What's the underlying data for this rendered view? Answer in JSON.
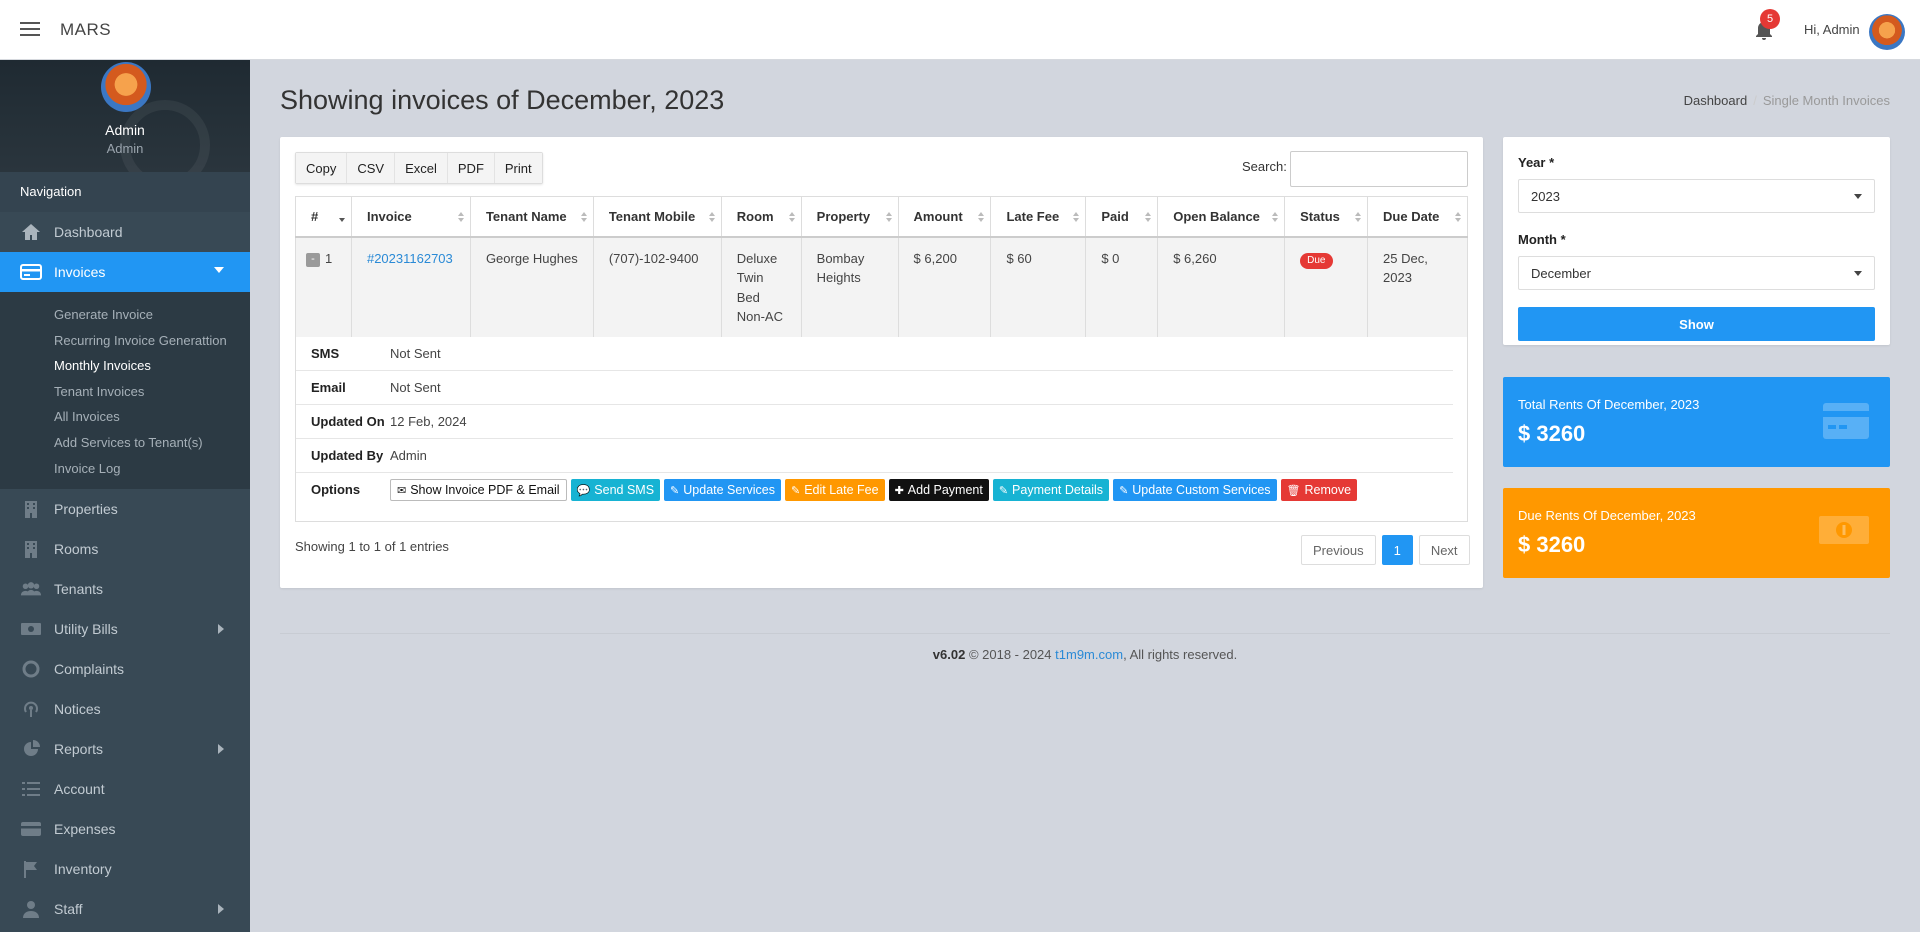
{
  "header": {
    "brand": "MARS",
    "notification_count": "5",
    "greeting": "Hi, Admin"
  },
  "sidebar": {
    "user_name": "Admin",
    "user_role": "Admin",
    "nav_header": "Navigation",
    "items": [
      {
        "label": "Dashboard",
        "icon": "home-icon"
      },
      {
        "label": "Invoices",
        "icon": "credit-card-icon"
      },
      {
        "label": "Properties",
        "icon": "building-icon"
      },
      {
        "label": "Rooms",
        "icon": "building-icon"
      },
      {
        "label": "Tenants",
        "icon": "users-icon"
      },
      {
        "label": "Utility Bills",
        "icon": "money-icon"
      },
      {
        "label": "Complaints",
        "icon": "lifebuoy-icon"
      },
      {
        "label": "Notices",
        "icon": "broadcast-icon"
      },
      {
        "label": "Reports",
        "icon": "chart-pie-icon"
      },
      {
        "label": "Account",
        "icon": "list-icon"
      },
      {
        "label": "Expenses",
        "icon": "credit-card-icon"
      },
      {
        "label": "Inventory",
        "icon": "flag-icon"
      },
      {
        "label": "Staff",
        "icon": "user-icon"
      }
    ],
    "submenu": [
      "Generate Invoice",
      "Recurring Invoice Generattion",
      "Monthly Invoices",
      "Tenant Invoices",
      "All Invoices",
      "Add Services to Tenant(s)",
      "Invoice Log"
    ]
  },
  "page": {
    "title": "Showing invoices of December, 2023",
    "breadcrumb_home": "Dashboard",
    "breadcrumb_current": "Single Month Invoices"
  },
  "table_tools": {
    "buttons": [
      "Copy",
      "CSV",
      "Excel",
      "PDF",
      "Print"
    ],
    "search_label": "Search:"
  },
  "table": {
    "columns": [
      "#",
      "Invoice",
      "Tenant Name",
      "Tenant Mobile",
      "Room",
      "Property",
      "Amount",
      "Late Fee",
      "Paid",
      "Open Balance",
      "Status",
      "Due Date"
    ],
    "row": {
      "toggle": "-",
      "num": "1",
      "invoice": "#20231162703",
      "tenant_name": "George Hughes",
      "tenant_mobile": "(707)-102-9400",
      "room_lines": [
        "Deluxe",
        "Twin",
        "Bed",
        "Non-AC"
      ],
      "property_lines": [
        "Bombay",
        "Heights"
      ],
      "amount": "$ 6,200",
      "late_fee": "$ 60",
      "paid": "$ 0",
      "open_balance": "$ 6,260",
      "status": "Due",
      "due_date_lines": [
        "25 Dec,",
        "2023"
      ]
    }
  },
  "details": {
    "sms_label": "SMS",
    "sms_value": "Not Sent",
    "email_label": "Email",
    "email_value": "Not Sent",
    "updated_on_label": "Updated On",
    "updated_on_value": "12 Feb, 2024",
    "updated_by_label": "Updated By",
    "updated_by_value": "Admin",
    "options_label": "Options",
    "options": [
      "Show Invoice PDF & Email",
      "Send SMS",
      "Update Services",
      "Edit Late Fee",
      "Add Payment",
      "Payment Details",
      "Update Custom Services",
      "Remove"
    ]
  },
  "pagination": {
    "info": "Showing 1 to 1 of 1 entries",
    "previous": "Previous",
    "page": "1",
    "next": "Next"
  },
  "filter": {
    "year_label": "Year *",
    "year_value": "2023",
    "month_label": "Month *",
    "month_value": "December",
    "show": "Show"
  },
  "stats": {
    "total_title": "Total Rents Of December, 2023",
    "total_value": "$ 3260",
    "due_title": "Due Rents Of December, 2023",
    "due_value": "$ 3260"
  },
  "footer": {
    "version": "v6.02",
    "copyright": "© 2018 - 2024",
    "site": "t1m9m.com",
    "rights": ", All rights reserved."
  },
  "colors": {
    "primary": "#2196f3",
    "warning": "#ff9800",
    "danger": "#e53935",
    "info": "#17b3d3",
    "sidebar": "#384955"
  }
}
